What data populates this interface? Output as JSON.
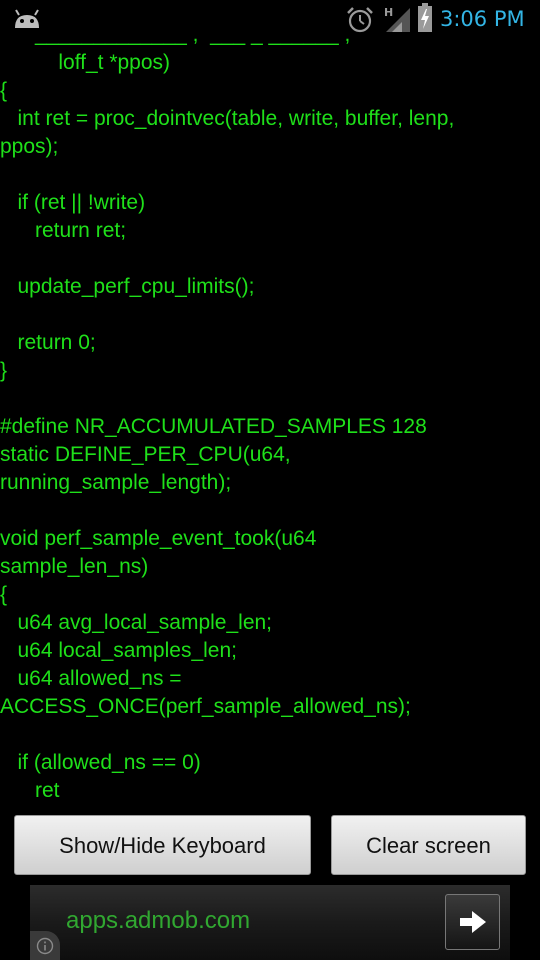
{
  "status_bar": {
    "time": "3:06 PM",
    "network_type": "H",
    "icons": [
      "android-notification-icon",
      "alarm-icon",
      "signal-icon",
      "battery-charging-icon"
    ],
    "time_color": "#33b5e5"
  },
  "terminal": {
    "text_color": "#1fe01a",
    "background": "#000000",
    "lines": [
      "      _____________ ,  ___ _ ______ ,",
      "          loff_t *ppos)",
      "{",
      "   int ret = proc_dointvec(table, write, buffer, lenp,",
      "ppos);",
      "",
      "   if (ret || !write)",
      "      return ret;",
      "",
      "   update_perf_cpu_limits();",
      "",
      "   return 0;",
      "}",
      "",
      "#define NR_ACCUMULATED_SAMPLES 128",
      "static DEFINE_PER_CPU(u64,",
      "running_sample_length);",
      "",
      "void perf_sample_event_took(u64",
      "sample_len_ns)",
      "{",
      "   u64 avg_local_sample_len;",
      "   u64 local_samples_len;",
      "   u64 allowed_ns =",
      "ACCESS_ONCE(perf_sample_allowed_ns);",
      "",
      "   if (allowed_ns == 0)",
      "      ret"
    ]
  },
  "buttons": {
    "show_hide_keyboard": "Show/Hide Keyboard",
    "clear_screen": "Clear screen"
  },
  "ad": {
    "text": "apps.admob.com",
    "text_color": "#31a831",
    "arrow_icon": "right-arrow-icon",
    "info_icon": "info-icon"
  }
}
